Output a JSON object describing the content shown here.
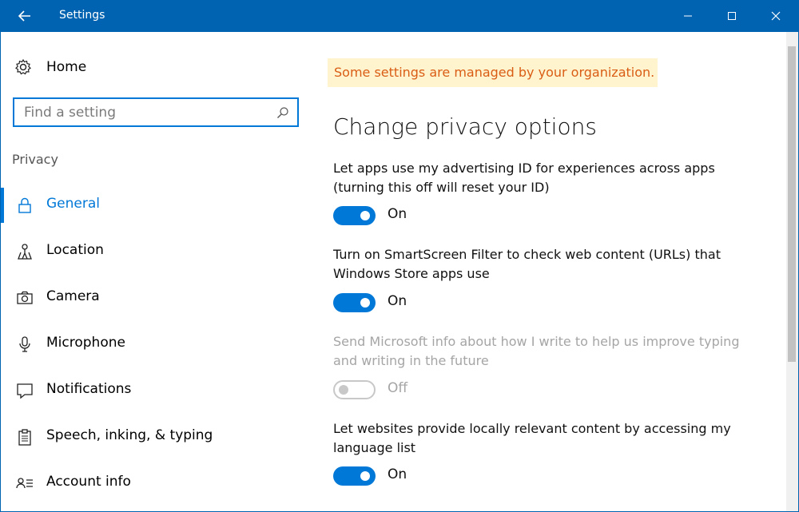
{
  "window": {
    "title": "Settings",
    "accent": "#0063b1"
  },
  "sidebar": {
    "home_label": "Home",
    "search_placeholder": "Find a setting",
    "section_label": "Privacy",
    "items": [
      {
        "label": "General",
        "icon": "lock-icon",
        "active": true
      },
      {
        "label": "Location",
        "icon": "location-person-icon",
        "active": false
      },
      {
        "label": "Camera",
        "icon": "camera-icon",
        "active": false
      },
      {
        "label": "Microphone",
        "icon": "microphone-icon",
        "active": false
      },
      {
        "label": "Notifications",
        "icon": "notification-icon",
        "active": false
      },
      {
        "label": "Speech, inking, & typing",
        "icon": "clipboard-icon",
        "active": false
      },
      {
        "label": "Account info",
        "icon": "account-info-icon",
        "active": false
      }
    ]
  },
  "main": {
    "banner_text": "Some settings are managed by your organization.",
    "heading": "Change privacy options",
    "settings": [
      {
        "line1": "Let apps use my advertising ID for experiences across apps",
        "line2": "(turning this off will reset your ID)",
        "state": "On",
        "enabled": true
      },
      {
        "line1": "Turn on SmartScreen Filter to check web content (URLs) that",
        "line2": "Windows Store apps use",
        "state": "On",
        "enabled": true
      },
      {
        "line1": "Send Microsoft info about how I write to help us improve typing",
        "line2": "and writing in the future",
        "state": "Off",
        "enabled": false
      },
      {
        "line1": "Let websites provide locally relevant content by accessing my",
        "line2": "language list",
        "state": "On",
        "enabled": true
      }
    ]
  },
  "colors": {
    "accent_blue": "#0078d7",
    "banner_bg": "#fff4ce",
    "banner_text": "#da5d15"
  }
}
